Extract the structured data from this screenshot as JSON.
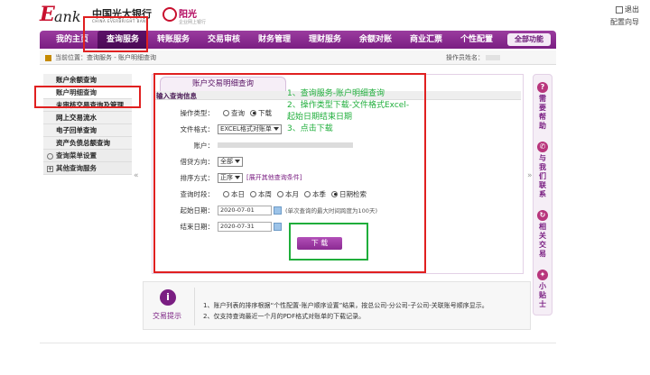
{
  "brand": {
    "e_letter": "E",
    "ank": "ank",
    "bank_cn": "中国光大银行",
    "bank_en": "CHINA EVERBRIGHT BANK",
    "sun_name": "阳光",
    "sun_sub": "企业网上银行"
  },
  "top_right": {
    "exit": "退出",
    "guide": "配置向导"
  },
  "nav": {
    "items": [
      "我的主页",
      "查询服务",
      "转账服务",
      "交易审核",
      "财务管理",
      "理财服务",
      "余额对账",
      "商业汇票",
      "个性配置"
    ],
    "full_function": "全部功能"
  },
  "crumb": {
    "text": "当前位置：查询服务 - 账户明细查询",
    "operator_label": "操作员姓名："
  },
  "sidebar": {
    "items": [
      "账户余额查询",
      "账户明细查询",
      "未审核交易查询及管理",
      "网上交易流水",
      "电子回单查询",
      "资产负债总额查询"
    ],
    "groups": [
      "查询菜单设置",
      "其他查询服务"
    ]
  },
  "form": {
    "tab_title": "账户交易明细查询",
    "section": "输入查询信息",
    "op_type_label": "操作类型：",
    "op_query": "查询",
    "op_download": "下载",
    "format_label": "文件格式：",
    "format_value": "EXCEL格式对账单",
    "account_label": "账户：",
    "direction_label": "借贷方向：",
    "direction_value": "全部",
    "sort_label": "排序方式：",
    "sort_value": "正序",
    "other_conditions": "[展开其他查询条件]",
    "period_label": "查询时段：",
    "periods": [
      "本日",
      "本周",
      "本月",
      "本季",
      "日期检索"
    ],
    "start_label": "起始日期：",
    "start_value": "2020-07-01",
    "end_label": "结束日期：",
    "end_value": "2020-07-31",
    "range_hint": "(单次查询的最大时间跨度为100天)",
    "download_btn": "下 载"
  },
  "annotation": {
    "line1": "1、查询服务-账户明细查询",
    "line2": "2、操作类型下载-文件格式Excel-",
    "line3": "起始日期结束日期",
    "line4": "3、点击下载"
  },
  "right_side": {
    "help": "需要帮助",
    "contact": "与我们联系",
    "related": "相关交易",
    "tips": "小贴士"
  },
  "tips": {
    "label": "交易提示",
    "line1": "1、账户列表的排序根据“个性配置-账户顺序设置”结果，按总公司-分公司-子公司-关联账号顺序显示。",
    "line2": "2、仅支持查询最近一个月的PDF格式对账单的下载记录。"
  },
  "colors": {
    "brand_purple": "#7a1e82",
    "annotation_green": "#1fae3b",
    "highlight_red": "#e02020"
  }
}
